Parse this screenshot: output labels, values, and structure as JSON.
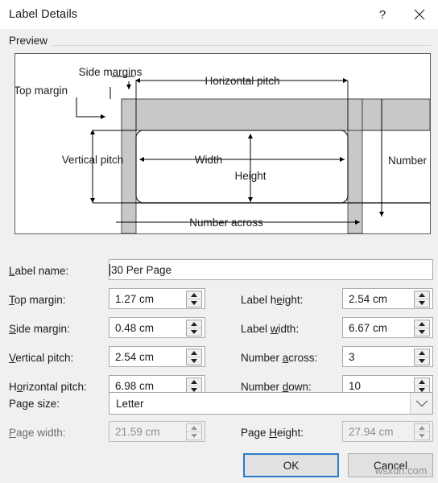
{
  "window": {
    "title": "Label Details",
    "help_icon": "question-mark-icon",
    "close_icon": "close-icon"
  },
  "preview": {
    "group_label": "Preview",
    "diagram_labels": {
      "side_margins": "Side margins",
      "top_margin": "Top margin",
      "horizontal_pitch": "Horizontal pitch",
      "number_down": "Number down",
      "vertical_pitch": "Vertical pitch",
      "width": "Width",
      "height": "Height",
      "number_across": "Number across"
    }
  },
  "form": {
    "label_name": {
      "label_pre": "L",
      "label_rest": "abel name:",
      "value": "30 Per Page"
    },
    "top_margin": {
      "label_pre": "T",
      "label_rest": "op margin:",
      "value": "1.27 cm"
    },
    "side_margin": {
      "label_pre": "S",
      "label_rest": "ide margin:",
      "value": "0.48 cm"
    },
    "vertical_pitch": {
      "label_pre": "V",
      "label_rest": "ertical pitch:",
      "value": "2.54 cm"
    },
    "horizontal_pitch": {
      "label_a": "H",
      "label_acc": "o",
      "label_rest": "rizontal pitch:",
      "value": "6.98 cm"
    },
    "label_height": {
      "label_a": "Label h",
      "label_acc": "e",
      "label_rest": "ight:",
      "value": "2.54 cm"
    },
    "label_width": {
      "label_a": "Label ",
      "label_acc": "w",
      "label_rest": "idth:",
      "value": "6.67 cm"
    },
    "number_across": {
      "label_a": "Number ",
      "label_acc": "a",
      "label_rest": "cross:",
      "value": "3"
    },
    "number_down": {
      "label_a": "Number ",
      "label_acc": "d",
      "label_rest": "own:",
      "value": "10"
    },
    "page_size": {
      "label": "Page size:",
      "value": "Letter"
    },
    "page_width": {
      "label_pre": "P",
      "label_rest": "age width:",
      "value": "21.59 cm"
    },
    "page_height": {
      "label_a": "Page ",
      "label_acc": "H",
      "label_rest": "eight:",
      "value": "27.94 cm"
    }
  },
  "footer": {
    "ok_label": "OK",
    "cancel_label": "Cancel"
  },
  "watermark": {
    "text": "wsxdn.com"
  }
}
